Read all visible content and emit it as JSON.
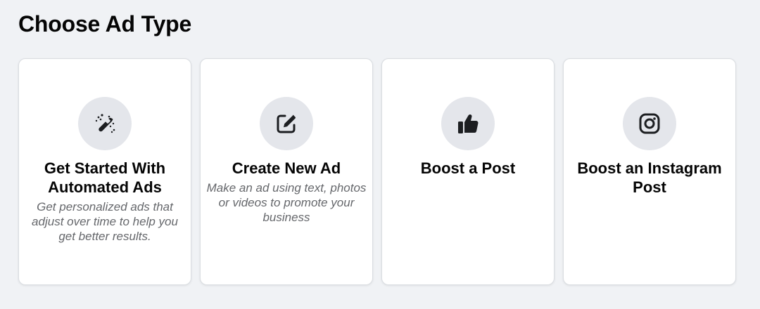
{
  "page_title": "Choose Ad Type",
  "cards": [
    {
      "title_line1": "Get Started With",
      "title_line2": "Automated Ads",
      "description": "Get personalized ads that adjust over time to help you get better results.",
      "icon": "magic-wand-icon"
    },
    {
      "title_line1": "Create New Ad",
      "description": "Make an ad using text, photos or videos to promote your business",
      "icon": "edit-icon"
    },
    {
      "title_line1": "Boost a Post",
      "icon": "thumbs-up-icon"
    },
    {
      "title_line1": "Boost an Instagram",
      "title_line2": "Post",
      "icon": "instagram-icon"
    }
  ],
  "colors": {
    "background": "#f0f2f5",
    "card": "#ffffff",
    "icon_circle": "#e4e6eb",
    "title_text": "#050505",
    "secondary_text": "#65676b"
  }
}
